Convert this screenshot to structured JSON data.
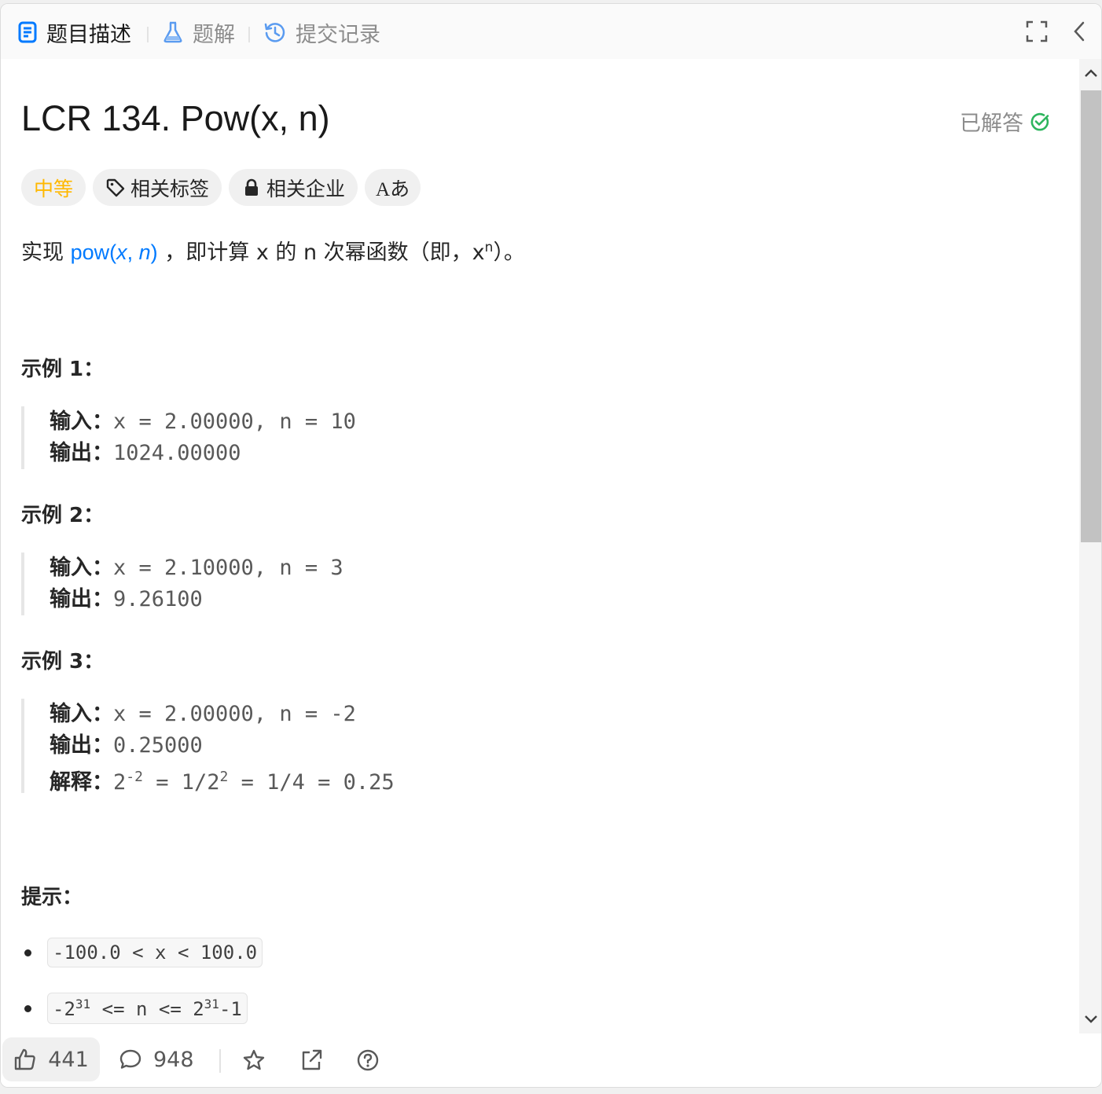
{
  "tabs": [
    {
      "label": "题目描述",
      "icon": "document-icon"
    },
    {
      "label": "题解",
      "icon": "flask-icon"
    },
    {
      "label": "提交记录",
      "icon": "history-icon"
    }
  ],
  "problem": {
    "title": "LCR 134. Pow(x, n)",
    "status": "已解答",
    "difficulty": "中等",
    "tags_label": "相关标签",
    "companies_label": "相关企业",
    "translate_label": "Aあ"
  },
  "description": {
    "prefix": "实现 ",
    "link_fn": "pow(",
    "link_x": "x",
    "link_sep": ", ",
    "link_n": "n",
    "link_close": ")",
    "mid": " ，即计算 x 的 n 次幂函数（即，x",
    "sup": "n",
    "suffix": "）。"
  },
  "examples": [
    {
      "heading": "示例 1：",
      "input_label": "输入：",
      "input": "x = 2.00000, n = 10",
      "output_label": "输出：",
      "output": "1024.00000"
    },
    {
      "heading": "示例 2：",
      "input_label": "输入：",
      "input": "x = 2.10000, n = 3",
      "output_label": "输出：",
      "output": "9.26100"
    },
    {
      "heading": "示例 3：",
      "input_label": "输入：",
      "input": "x = 2.00000, n = -2",
      "output_label": "输出：",
      "output": "0.25000",
      "explain_label": "解释：",
      "explain_base1": "2",
      "explain_exp1": "-2",
      "explain_mid": " = 1/2",
      "explain_exp2": "2",
      "explain_tail": " = 1/4 = 0.25"
    }
  ],
  "tips": {
    "heading": "提示：",
    "tip1": "-100.0 < x < 100.0",
    "tip2_a": "-2",
    "tip2_exp1": "31",
    "tip2_b": " <= n <= 2",
    "tip2_exp2": "31",
    "tip2_c": "-1"
  },
  "footer": {
    "likes": "441",
    "comments": "948"
  },
  "colors": {
    "accent": "#007aff",
    "difficulty_medium": "#ffb800",
    "solved_green": "#2db55d"
  }
}
